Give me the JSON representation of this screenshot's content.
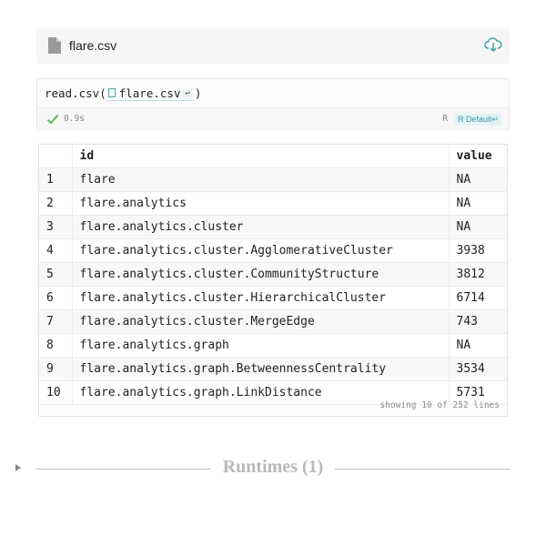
{
  "file": {
    "name": "flare.csv",
    "icon": "file-icon",
    "action_icon": "cloud-upload-icon"
  },
  "cell": {
    "code_prefix": "read.csv(",
    "code_arg": "flare.csv",
    "return_glyph": "↩",
    "code_suffix": ")",
    "runtime": "0.9s",
    "status_icon": "check-icon",
    "status_color": "#5cb85c",
    "language": "R",
    "kernel": "R Default↵"
  },
  "table": {
    "columns": [
      "",
      "id",
      "value"
    ],
    "rows": [
      [
        "1",
        "flare",
        "NA"
      ],
      [
        "2",
        "flare.analytics",
        "NA"
      ],
      [
        "3",
        "flare.analytics.cluster",
        "NA"
      ],
      [
        "4",
        "flare.analytics.cluster.AgglomerativeCluster",
        "3938"
      ],
      [
        "5",
        "flare.analytics.cluster.CommunityStructure",
        "3812"
      ],
      [
        "6",
        "flare.analytics.cluster.HierarchicalCluster",
        "6714"
      ],
      [
        "7",
        "flare.analytics.cluster.MergeEdge",
        "743"
      ],
      [
        "8",
        "flare.analytics.graph",
        "NA"
      ],
      [
        "9",
        "flare.analytics.graph.BetweennessCentrality",
        "3534"
      ],
      [
        "10",
        "flare.analytics.graph.LinkDistance",
        "5731"
      ]
    ],
    "footer": "showing 10 of 252 lines"
  },
  "runtimes": {
    "title": "Runtimes (1)"
  },
  "colors": {
    "accent": "#3a9da8",
    "muted": "#888888"
  }
}
